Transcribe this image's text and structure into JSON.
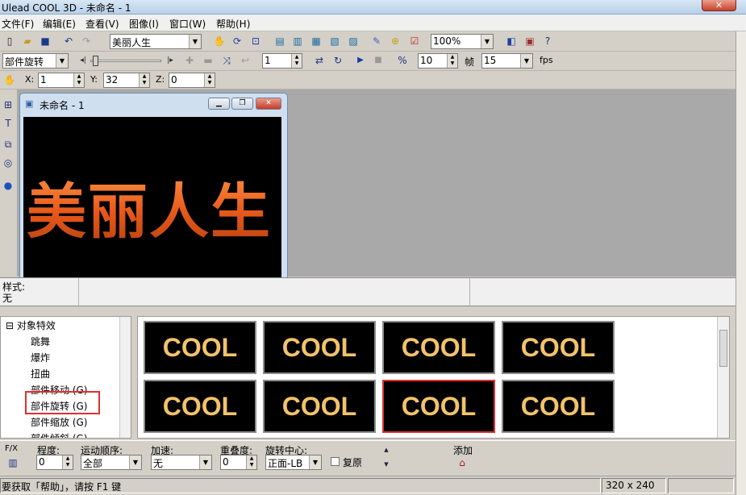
{
  "window": {
    "title": "Ulead COOL 3D - 未命名 - 1",
    "close_glyph": "✕"
  },
  "menu": [
    "文件(F)",
    "编辑(E)",
    "查看(V)",
    "图像(I)",
    "窗口(W)",
    "帮助(H)"
  ],
  "toolbar1": {
    "text_object_value": "美丽人生",
    "zoom_value": "100%"
  },
  "toolbar2": {
    "tool_value": "部件旋转",
    "frame_value": "1",
    "count_value": "10",
    "frame_label": "帧",
    "fps_value": "15",
    "fps_label": "fps"
  },
  "toolbar3": {
    "x_label": "X:",
    "x_value": "1",
    "y_label": "Y:",
    "y_value": "32",
    "z_label": "Z:",
    "z_value": "0"
  },
  "document": {
    "title": "未命名 - 1",
    "canvas_text": "美丽人生"
  },
  "style_panel": {
    "label": "样式:",
    "value": "无"
  },
  "tree": {
    "root": "对象特效",
    "items": [
      "跳舞",
      "爆炸",
      "扭曲",
      "部件移动 (G)",
      "部件旋转 (G)",
      "部件缩放 (G)",
      "部件倾斜 (G)"
    ]
  },
  "gallery": {
    "thumbs": [
      "COOL",
      "COOL",
      "COOL",
      "COOL",
      "COOL",
      "COOL",
      "COOL",
      "COOL"
    ]
  },
  "bottom": {
    "fx_label": "F/X",
    "degree_label": "程度:",
    "degree_value": "0",
    "order_label": "运动顺序:",
    "order_value": "全部",
    "accel_label": "加速:",
    "accel_value": "无",
    "overlap_label": "重叠度:",
    "overlap_value": "0",
    "center_label": "旋转中心:",
    "center_value": "正面-LB",
    "reset_label": "复原",
    "add_label": "添加"
  },
  "status": {
    "hint": "要获取「帮助」，请按 F1 键",
    "size": "320 x 240"
  },
  "colors": {
    "highlight": "#e03030",
    "canvas_text": "#f07a30",
    "thumb_text": "#f2c36b"
  },
  "icons": [
    "new-file-icon",
    "open-folder-icon",
    "save-icon",
    "undo-icon",
    "redo-icon",
    "hand-icon",
    "rotate-icon",
    "zoom-fit-icon",
    "globe-icon",
    "help-icon"
  ]
}
